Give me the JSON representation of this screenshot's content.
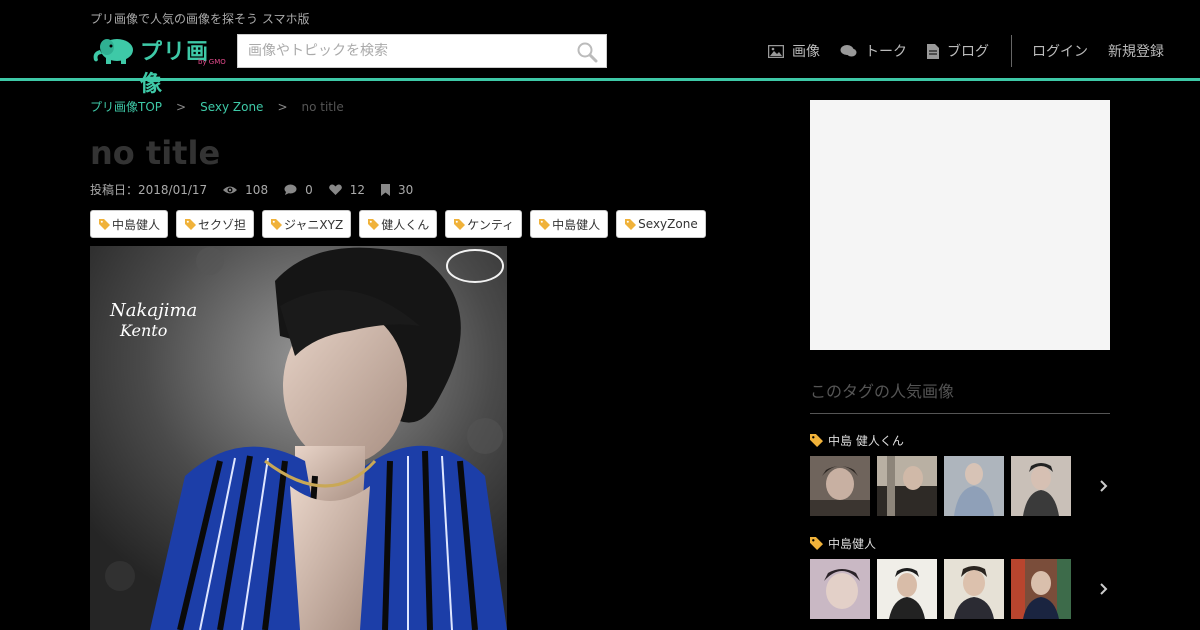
{
  "header": {
    "site_description": "プリ画像で人気の画像を探そう スマホ版",
    "logo_text": "プリ画像",
    "logo_sub": "by GMO",
    "search_placeholder": "画像やトピックを検索",
    "nav": [
      {
        "icon": "image-icon",
        "label": "画像"
      },
      {
        "icon": "comment-icon",
        "label": "トーク"
      },
      {
        "icon": "file-icon",
        "label": "ブログ"
      }
    ],
    "auth_links": [
      "ログイン",
      "新規登録"
    ],
    "accent_color": "#3ec9a7"
  },
  "breadcrumb": {
    "home": "プリ画像TOP",
    "category": "Sexy Zone",
    "current": "no title",
    "separator": ">"
  },
  "title": "no title",
  "meta": {
    "date": "投稿日：2018/01/17",
    "views": "108",
    "comments": "0",
    "likes": "12",
    "bookmarks": "30"
  },
  "tags": [
    "中島健人",
    "セクゾ担",
    "ジャニXYZ",
    "健人くん",
    "ケンティ",
    "中島健人",
    "SexyZone"
  ],
  "image": {
    "overlay_text_1": "Nakajima",
    "overlay_text_2": "Kento"
  },
  "sidebar": {
    "heading": "このタグの人気画像",
    "groups": [
      {
        "title": "中島 健人くん",
        "thumb_count": 4
      },
      {
        "title": "中島健人",
        "thumb_count": 4
      }
    ]
  }
}
